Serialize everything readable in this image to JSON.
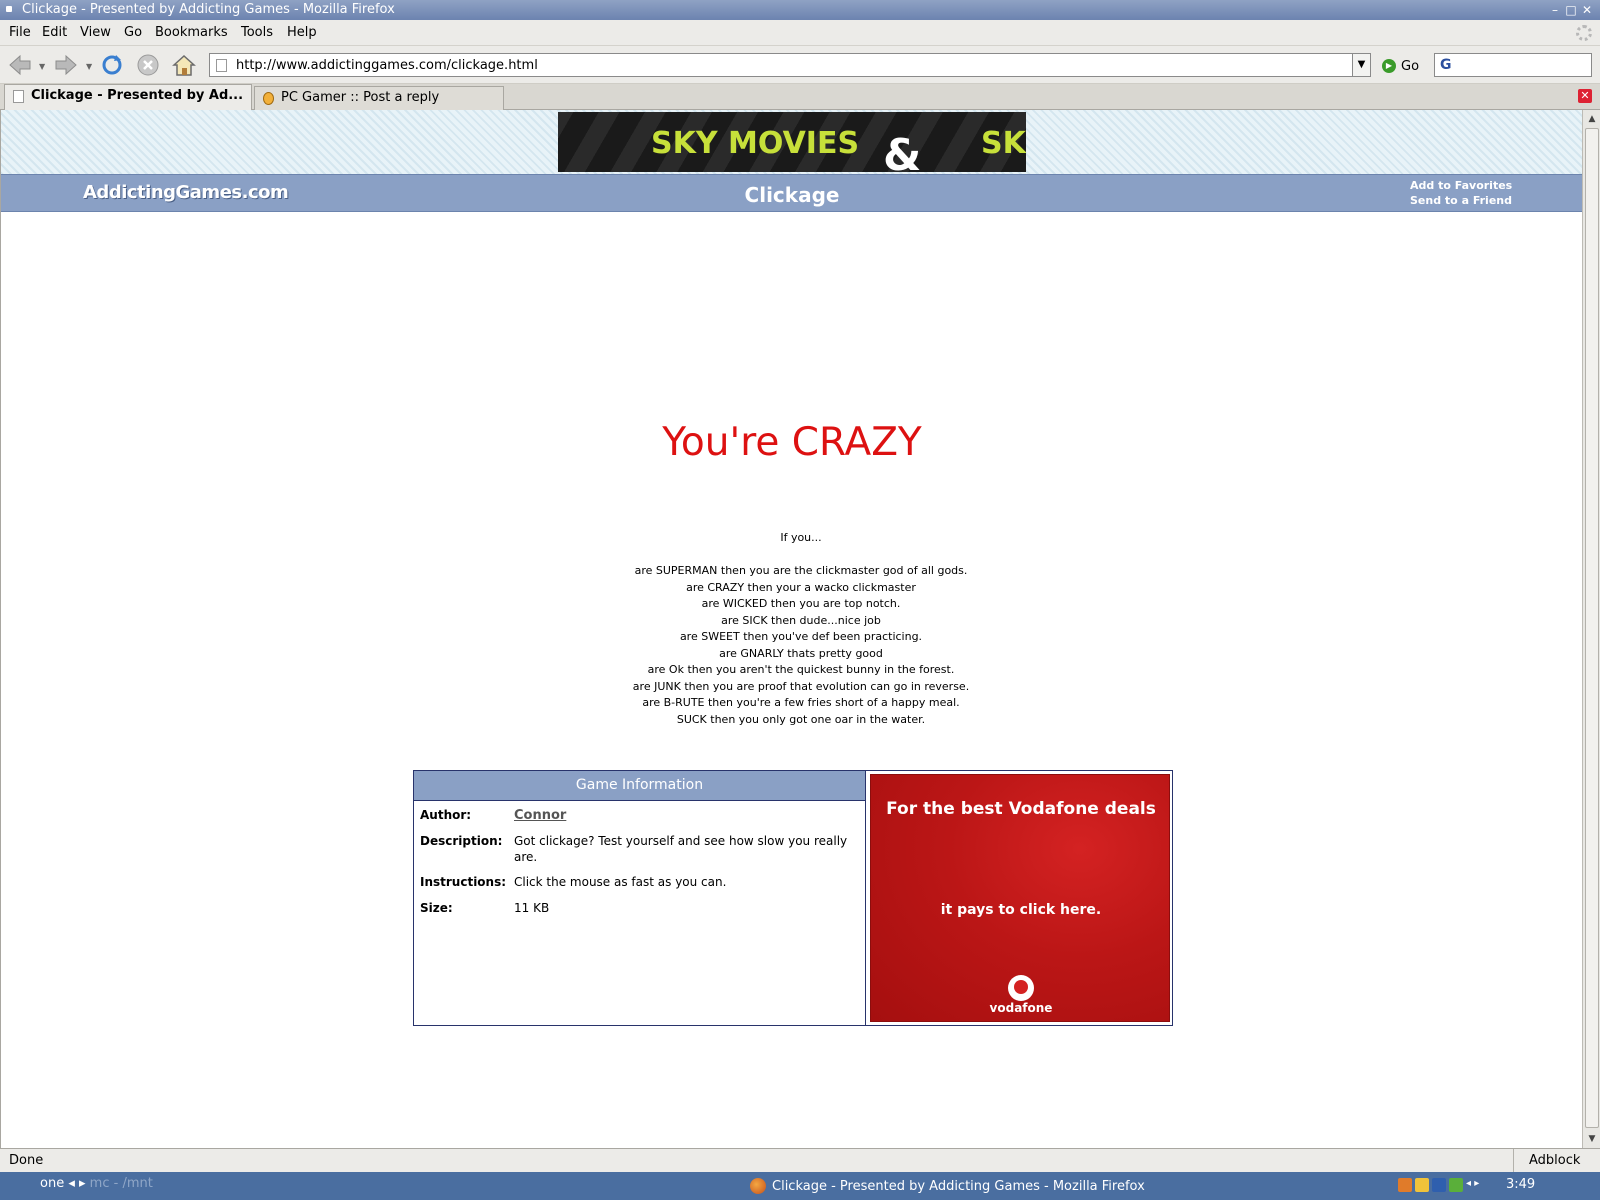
{
  "window": {
    "title": "Clickage - Presented by Addicting Games - Mozilla Firefox"
  },
  "menu": {
    "items": [
      "File",
      "Edit",
      "View",
      "Go",
      "Bookmarks",
      "Tools",
      "Help"
    ]
  },
  "toolbar": {
    "url": "http://www.addictinggames.com/clickage.html",
    "go_label": "Go"
  },
  "tabs": [
    {
      "label": "Clickage - Presented by Ad...",
      "active": true
    },
    {
      "label": "PC Gamer :: Post a reply",
      "active": false
    }
  ],
  "page": {
    "top_ad": {
      "text_left": "SKY MOVIES",
      "amp": "&",
      "text_right": "SKY"
    },
    "site": {
      "logo": "AddictingGames.com",
      "game_title": "Clickage",
      "links": [
        "Add to Favorites",
        "Send to a Friend"
      ]
    },
    "result_title": "You're CRAZY",
    "if_intro": "If you...",
    "ranks": [
      "are SUPERMAN then you are the clickmaster god of all gods.",
      "are CRAZY then your a wacko clickmaster",
      "are WICKED then you are top notch.",
      "are SICK then dude...nice job",
      "are SWEET then you've def been practicing.",
      "are GNARLY thats pretty good",
      "are Ok then you aren't the quickest bunny in the forest.",
      "are JUNK then you are proof that evolution can go in reverse.",
      "are B-RUTE then you're a few fries short of a happy meal.",
      "SUCK then you only got one oar in the water."
    ],
    "info": {
      "heading": "Game Information",
      "author_label": "Author:",
      "author": "Connor",
      "description_label": "Description:",
      "description": "Got clickage? Test yourself and see how slow you really are.",
      "instructions_label": "Instructions:",
      "instructions": "Click the mouse as fast as you can.",
      "size_label": "Size:",
      "size": "11 KB"
    },
    "side_ad": {
      "line1": "For the best Vodafone deals",
      "line2": "it pays to click here.",
      "brand": "vodafone"
    }
  },
  "status": {
    "text": "Done",
    "addon": "Adblock"
  },
  "taskbar": {
    "workspace": "one",
    "workspace_dim": "mc - /mnt",
    "task": "Clickage - Presented by Addicting Games - Mozilla Firefox",
    "clock": "3:49"
  },
  "colors": {
    "accent": "#8aa0c5",
    "result_red": "#dd1111",
    "ad_red": "#c01a1a",
    "border_navy": "#28336b"
  }
}
